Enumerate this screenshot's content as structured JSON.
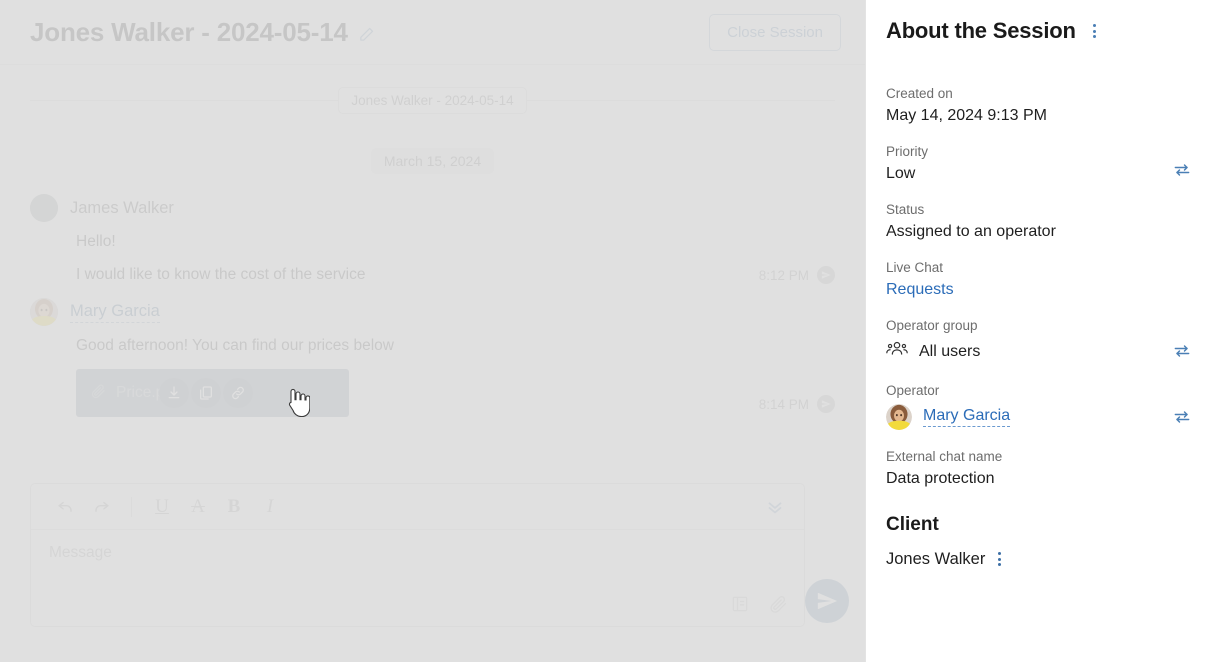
{
  "chat": {
    "header": {
      "session_title": "Jones Walker - 2024-05-14",
      "edit_icon": "pencil-icon",
      "close_session_label": "Close Session"
    },
    "session_chip": "Jones Walker - 2024-05-14",
    "date_chip": "March 15, 2024",
    "messages": [
      {
        "author": "James Walker",
        "author_is_link": false,
        "avatar": "gray-placeholder-avatar",
        "lines": [
          "Hello!",
          "I would like to know the cost of the service"
        ],
        "time": "8:12 PM",
        "status_icon": "sent-icon"
      },
      {
        "author": "Mary Garcia",
        "author_is_link": true,
        "avatar": "photo-avatar-mary",
        "lines": [
          "Good afternoon! You can find our prices below"
        ],
        "attachment": {
          "name": "Price.p",
          "clip_icon": "paperclip-icon",
          "actions": [
            {
              "name": "download-icon"
            },
            {
              "name": "copy-icon"
            },
            {
              "name": "link-icon"
            }
          ]
        },
        "time": "8:14 PM",
        "status_icon": "sent-icon"
      }
    ],
    "composer": {
      "toolbar": [
        {
          "name": "undo-icon",
          "label": "↩"
        },
        {
          "name": "redo-icon",
          "label": "↪"
        },
        {
          "name": "underline-icon",
          "label": "U"
        },
        {
          "name": "strikethrough-icon",
          "label": "A"
        },
        {
          "name": "bold-icon",
          "label": "B"
        },
        {
          "name": "italic-icon",
          "label": "I"
        }
      ],
      "expand_icon": "double-chevron-down-icon",
      "placeholder": "Message",
      "knowledge_base_icon": "book-icon",
      "attach_icon": "paperclip-icon",
      "send_icon": "send-plane-icon"
    }
  },
  "about": {
    "title": "About the Session",
    "menu_icon": "kebab-menu-icon",
    "fields": [
      {
        "label": "Created on",
        "value": "May 14, 2024 9:13 PM",
        "swap": false,
        "style": "plain"
      },
      {
        "label": "Priority",
        "value": "Low",
        "swap": true,
        "style": "plain"
      },
      {
        "label": "Status",
        "value": "Assigned to an operator",
        "swap": false,
        "style": "plain"
      },
      {
        "label": "Live Chat",
        "value": "Requests",
        "swap": false,
        "style": "link"
      },
      {
        "label": "Operator group",
        "value": "All users",
        "swap": true,
        "style": "group",
        "icon": "users-group-icon"
      },
      {
        "label": "Operator",
        "value": "Mary Garcia",
        "swap": true,
        "style": "operator",
        "icon": "photo-avatar-mary"
      },
      {
        "label": "External chat name",
        "value": "Data protection",
        "swap": false,
        "style": "plain"
      }
    ],
    "client": {
      "heading": "Client",
      "name": "Jones Walker",
      "menu_icon": "kebab-menu-icon"
    }
  },
  "colors": {
    "accent_blue": "#2b6cb8",
    "muted_blue": "#7d9cb9",
    "overlay": "#dbdbdb",
    "attachment_bubble": "#97a2ae"
  }
}
